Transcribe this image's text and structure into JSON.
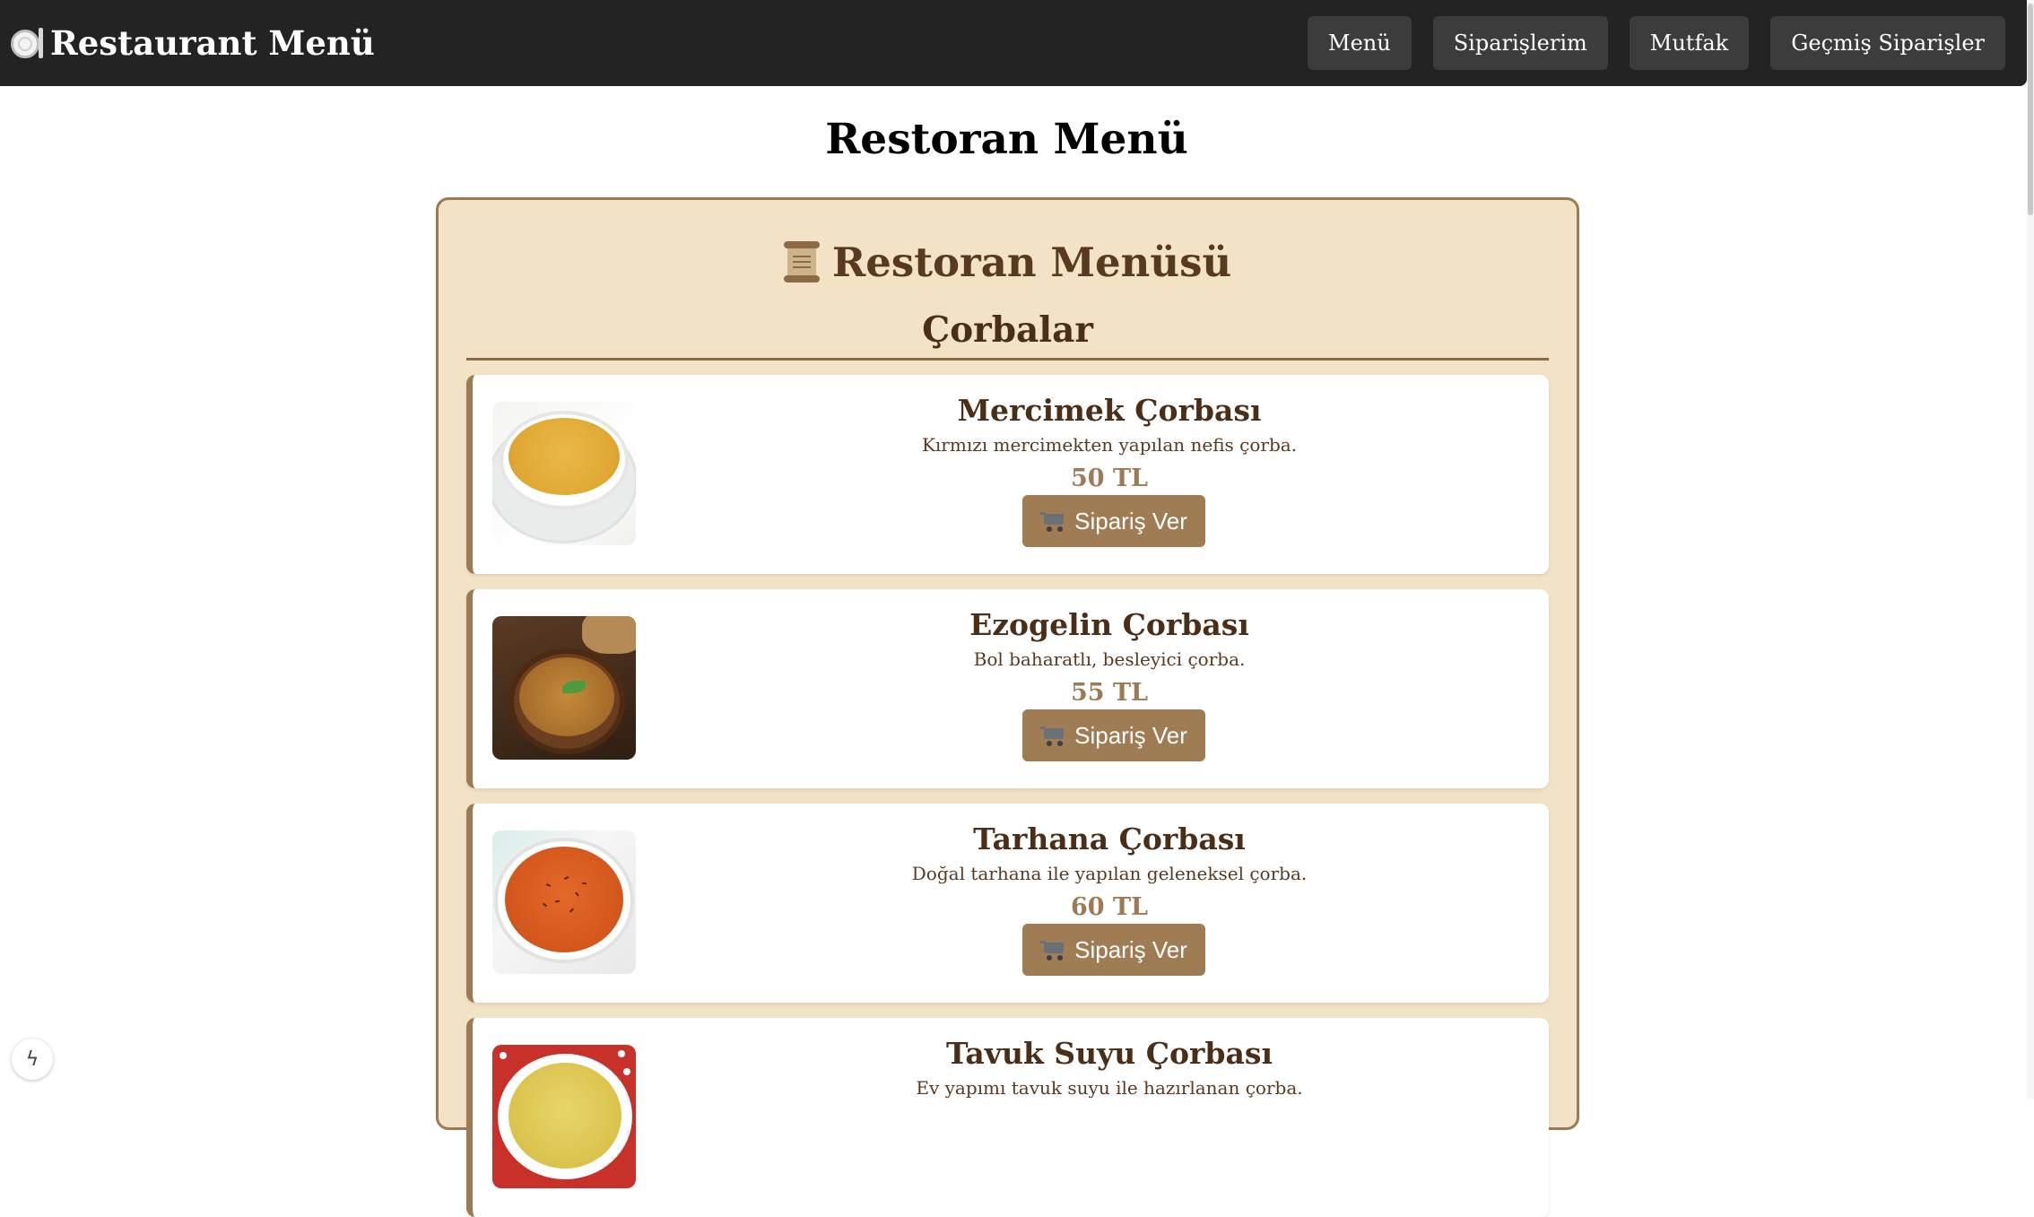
{
  "navbar": {
    "brand": "Restaurant Menü",
    "links": [
      {
        "label": "Menü"
      },
      {
        "label": "Siparişlerim"
      },
      {
        "label": "Mutfak"
      },
      {
        "label": "Geçmiş Siparişler"
      }
    ]
  },
  "page": {
    "title": "Restoran Menü"
  },
  "menu": {
    "title": "Restoran Menüsü",
    "icon": "scroll-icon",
    "category": "Çorbalar",
    "order_label": "Sipariş Ver",
    "items": [
      {
        "name": "Mercimek Çorbası",
        "description": "Kırmızı mercimekten yapılan nefis çorba.",
        "price": "50 TL",
        "image": "lentil-soup-image"
      },
      {
        "name": "Ezogelin Çorbası",
        "description": "Bol baharatlı, besleyici çorba.",
        "price": "55 TL",
        "image": "ezogelin-soup-image"
      },
      {
        "name": "Tarhana Çorbası",
        "description": "Doğal tarhana ile yapılan geleneksel çorba.",
        "price": "60 TL",
        "image": "tarhana-soup-image"
      },
      {
        "name": "Tavuk Suyu Çorbası",
        "description": "Ev yapımı tavuk suyu ile hazırlanan çorba.",
        "price": "",
        "image": "chicken-soup-image"
      }
    ]
  },
  "colors": {
    "navbar_bg": "#232323",
    "panel_bg": "#f2e2c6",
    "accent": "#9b7a55",
    "heading": "#4b2e17"
  }
}
